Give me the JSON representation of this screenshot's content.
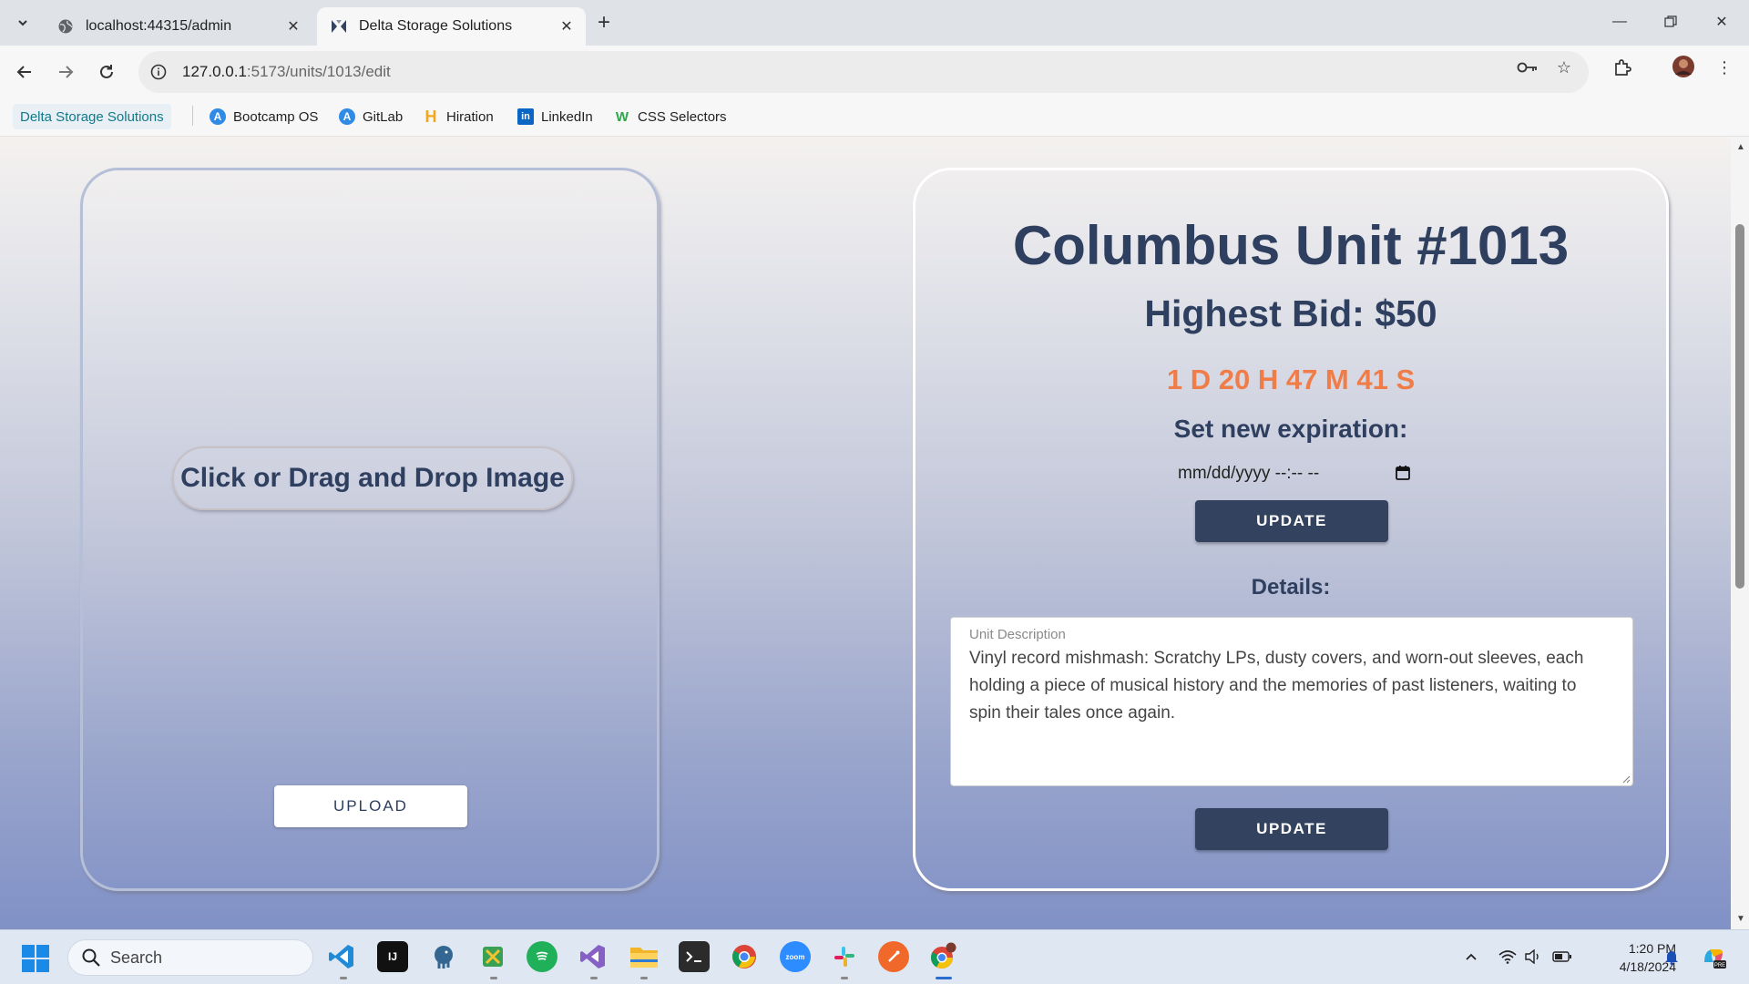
{
  "browser": {
    "tabs": [
      {
        "title": "localhost:44315/admin",
        "active": false
      },
      {
        "title": "Delta Storage Solutions",
        "active": true
      }
    ],
    "url_host": "127.0.0.1",
    "url_path": ":5173/units/1013/edit",
    "bookmarks": [
      {
        "label": "Delta Storage Solutions"
      },
      {
        "label": "Bootcamp OS"
      },
      {
        "label": "GitLab"
      },
      {
        "label": "Hiration"
      },
      {
        "label": "LinkedIn"
      },
      {
        "label": "CSS Selectors"
      }
    ]
  },
  "image_panel": {
    "drop_label": "Click or Drag and Drop Image",
    "upload_label": "UPLOAD"
  },
  "unit": {
    "title": "Columbus Unit #1013",
    "highest_bid": "Highest Bid: $50",
    "countdown": "1 D 20 H 47 M 41 S",
    "set_expiration_label": "Set new expiration:",
    "date_placeholder": "mm/dd/yyyy --:-- --",
    "update_label": "UPDATE",
    "details_label": "Details:",
    "description_label": "Unit Description",
    "description": "Vinyl record mishmash: Scratchy LPs, dusty covers, and worn-out sleeves, each holding a piece of musical history and the memories of past listeners, waiting to spin their tales once again.",
    "update_label_2": "UPDATE"
  },
  "taskbar": {
    "search_placeholder": "Search",
    "time": "1:20 PM",
    "date": "4/18/2024"
  },
  "colors": {
    "primary_navy": "#33425e",
    "countdown_orange": "#f07d47",
    "heading_text": "#2f3f5f"
  }
}
